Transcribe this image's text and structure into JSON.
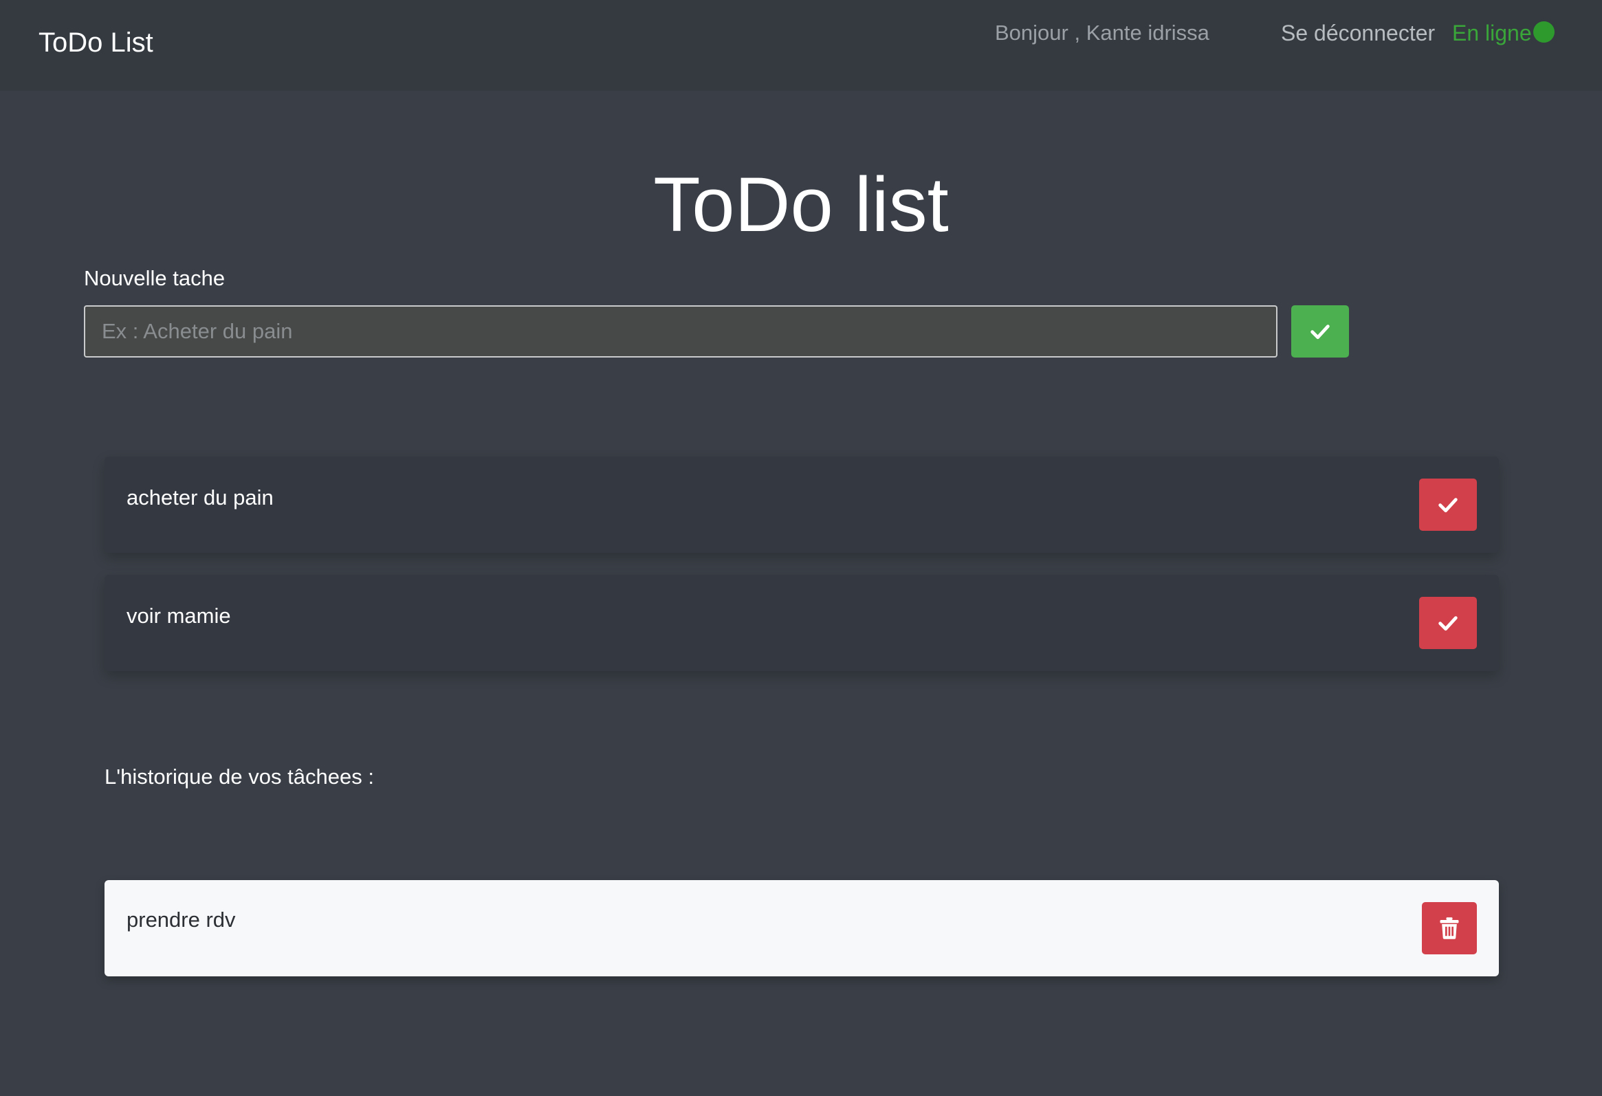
{
  "navbar": {
    "brand": "ToDo List",
    "greeting": "Bonjour , Kante idrissa",
    "logout_label": "Se déconnecter",
    "status_label": "En ligne",
    "status_color": "#2e9a2e"
  },
  "main": {
    "title": "ToDo list",
    "new_task_label": "Nouvelle tache",
    "new_task_placeholder": "Ex : Acheter du pain",
    "new_task_value": "",
    "add_button_icon": "check-icon"
  },
  "tasks": [
    {
      "text": "acheter du pain",
      "action_icon": "check-icon"
    },
    {
      "text": "voir mamie",
      "action_icon": "check-icon"
    }
  ],
  "history": {
    "title": "L'historique de vos tâchees :",
    "items": [
      {
        "text": "prendre rdv",
        "action_icon": "trash-icon"
      }
    ]
  },
  "colors": {
    "background": "#3a3f47",
    "navbar": "#343a40",
    "success": "#4caf50",
    "danger": "#d2414b"
  }
}
